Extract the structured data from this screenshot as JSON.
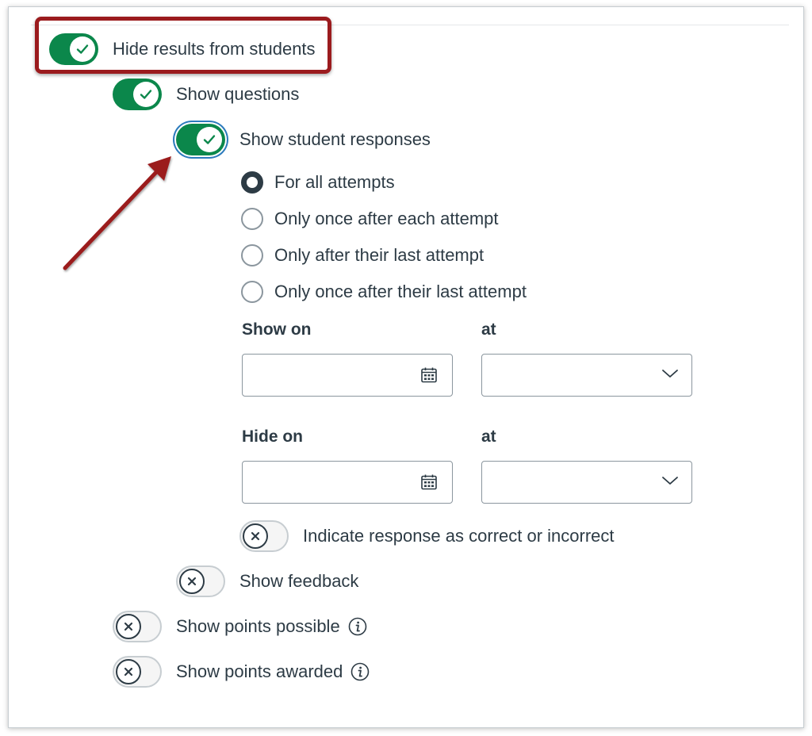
{
  "settings": {
    "hide_results": {
      "label": "Hide results from students",
      "on": true
    },
    "show_questions": {
      "label": "Show questions",
      "on": true
    },
    "show_responses": {
      "label": "Show student responses",
      "on": true
    },
    "attempt_options": [
      {
        "label": "For all attempts",
        "checked": true
      },
      {
        "label": "Only once after each attempt",
        "checked": false
      },
      {
        "label": "Only after their last attempt",
        "checked": false
      },
      {
        "label": "Only once after their last attempt",
        "checked": false
      }
    ],
    "show_on": {
      "label": "Show on",
      "date_value": "",
      "at_label": "at",
      "time_value": ""
    },
    "hide_on": {
      "label": "Hide on",
      "date_value": "",
      "at_label": "at",
      "time_value": ""
    },
    "indicate_correct": {
      "label": "Indicate response as correct or incorrect",
      "on": false
    },
    "show_feedback": {
      "label": "Show feedback",
      "on": false
    },
    "show_points_possible": {
      "label": "Show points possible",
      "on": false
    },
    "show_points_awarded": {
      "label": "Show points awarded",
      "on": false
    }
  },
  "icons": {
    "check": "check-icon",
    "x": "x-icon",
    "calendar": "calendar-icon",
    "chevron": "chevron-down-icon",
    "info": "info-icon"
  },
  "colors": {
    "toggle_on": "#0b874b",
    "annotation": "#9b1b1e",
    "focus_ring": "#2b7abc",
    "text": "#2d3b45"
  }
}
